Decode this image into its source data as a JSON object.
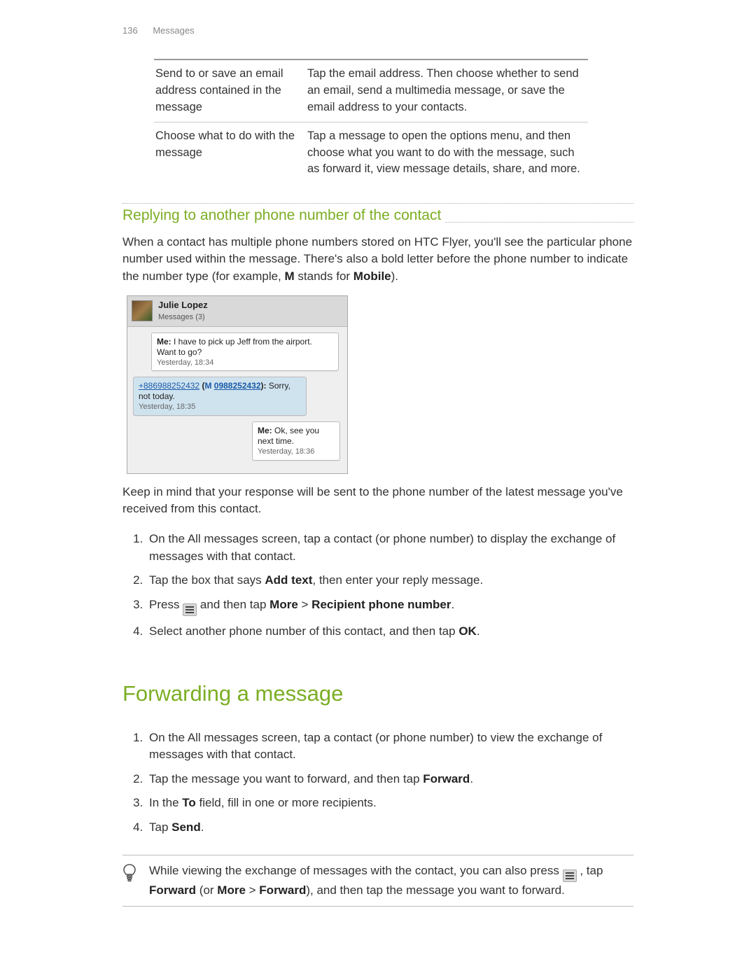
{
  "header": {
    "page_number": "136",
    "section": "Messages"
  },
  "table_rows": [
    {
      "action": "Send to or save an email address contained in the message",
      "desc": "Tap the email address. Then choose whether to send an email, send a multimedia message, or save the email address to your contacts."
    },
    {
      "action": "Choose what to do with the message",
      "desc": "Tap a message to open the options menu, and then choose what you want to do with the message, such as forward it, view message details, share, and more."
    }
  ],
  "sec1": {
    "title": "Replying to another phone number of the contact",
    "intro_a": "When a contact has multiple phone numbers stored on HTC Flyer, you'll see the particular phone number used within the message. There's also a bold letter before the phone number to indicate the number type (for example, ",
    "intro_m": "M",
    "intro_b": " stands for ",
    "intro_mobile": "Mobile",
    "intro_c": ")."
  },
  "phone": {
    "name": "Julie Lopez",
    "sub": "Messages (3)",
    "m1_pre": "Me:",
    "m1_txt": " I have to pick up Jeff from the airport. Want to go?",
    "m1_ts": "Yesterday, 18:34",
    "m2_num": "+886988252432",
    "m2_label": "M",
    "m2_short": "0988252432",
    "m2_txt": " Sorry, not today.",
    "m2_ts": "Yesterday, 18:35",
    "m3_pre": "Me:",
    "m3_txt": " Ok, see you next time.",
    "m3_ts": "Yesterday, 18:36"
  },
  "sec1_cont": "Keep in mind that your response will be sent to the phone number of the latest message you've received from this contact.",
  "steps1": {
    "s1": "On the All messages screen, tap a contact (or phone number) to display the exchange of messages with that contact.",
    "s2_a": "Tap the box that says ",
    "s2_add": "Add text",
    "s2_b": ", then enter your reply message.",
    "s3_a": "Press ",
    "s3_b": " and then tap ",
    "s3_more": "More",
    "s3_gt": " > ",
    "s3_rpn": "Recipient phone number",
    "s3_c": ".",
    "s4_a": "Select another phone number of this contact, and then tap ",
    "s4_ok": "OK",
    "s4_b": "."
  },
  "h2": "Forwarding a message",
  "steps2": {
    "s1": "On the All messages screen, tap a contact (or phone number) to view the exchange of messages with that contact.",
    "s2_a": "Tap the message you want to forward, and then tap ",
    "s2_fwd": "Forward",
    "s2_b": ".",
    "s3_a": "In the ",
    "s3_to": "To",
    "s3_b": " field, fill in one or more recipients.",
    "s4_a": "Tap ",
    "s4_send": "Send",
    "s4_b": "."
  },
  "tip": {
    "a": "While viewing the exchange of messages with the contact, you can also press ",
    "b": " , tap ",
    "fwd": "Forward",
    "c": " (or ",
    "more": "More",
    "gt": " > ",
    "fwd2": "Forward",
    "d": "), and then tap the message you want to forward."
  }
}
